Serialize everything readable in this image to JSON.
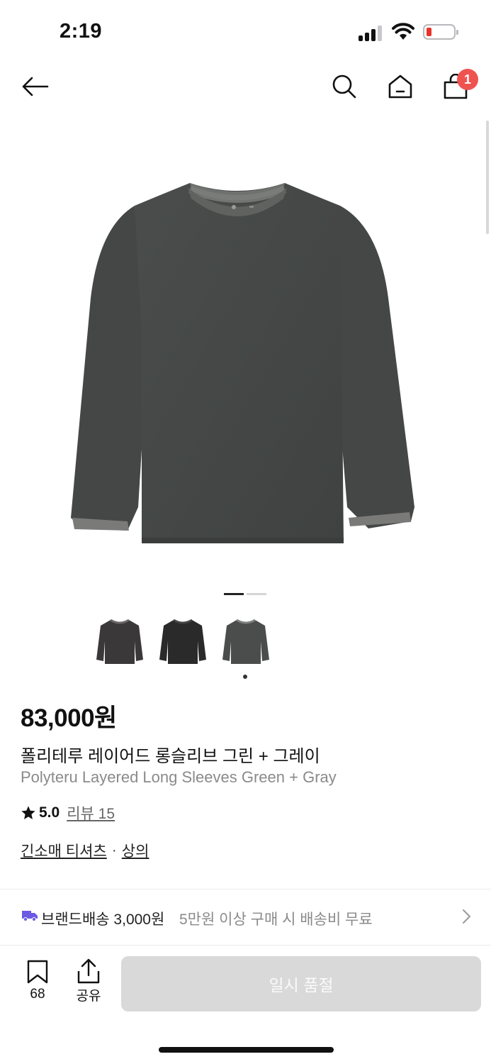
{
  "status_bar": {
    "time": "2:19",
    "battery_color": "#e8332c"
  },
  "nav": {
    "back_icon": "arrow-left-icon",
    "search_icon": "search-icon",
    "home_icon": "home-icon",
    "cart_icon": "shopping-bag-icon",
    "cart_badge": "1",
    "badge_color": "#ef5350"
  },
  "gallery": {
    "image_count": 2,
    "current_index": 1
  },
  "color_options": [
    {
      "name": "charcoal-gray",
      "color": "#3a3a3a"
    },
    {
      "name": "black",
      "color": "#2a2a2a"
    },
    {
      "name": "green-gray",
      "color": "#4a4d4c",
      "selected": true
    }
  ],
  "product": {
    "price": "83,000원",
    "name_ko": "폴리테루 레이어드 롱슬리브 그린 + 그레이",
    "name_en": "Polyteru Layered Long Sleeves Green + Gray",
    "rating": "5.0",
    "reviews": "리뷰 15",
    "category_1": "긴소매 티셔츠",
    "category_sep": "·",
    "category_2": "상의"
  },
  "shipping": {
    "label": "브랜드배송 3,000원",
    "note": "5만원 이상 구매 시 배송비 무료",
    "icon_color": "#6a5be2"
  },
  "bottom_bar": {
    "like_count": "68",
    "share_label": "공유",
    "soldout_label": "일시 품절"
  }
}
